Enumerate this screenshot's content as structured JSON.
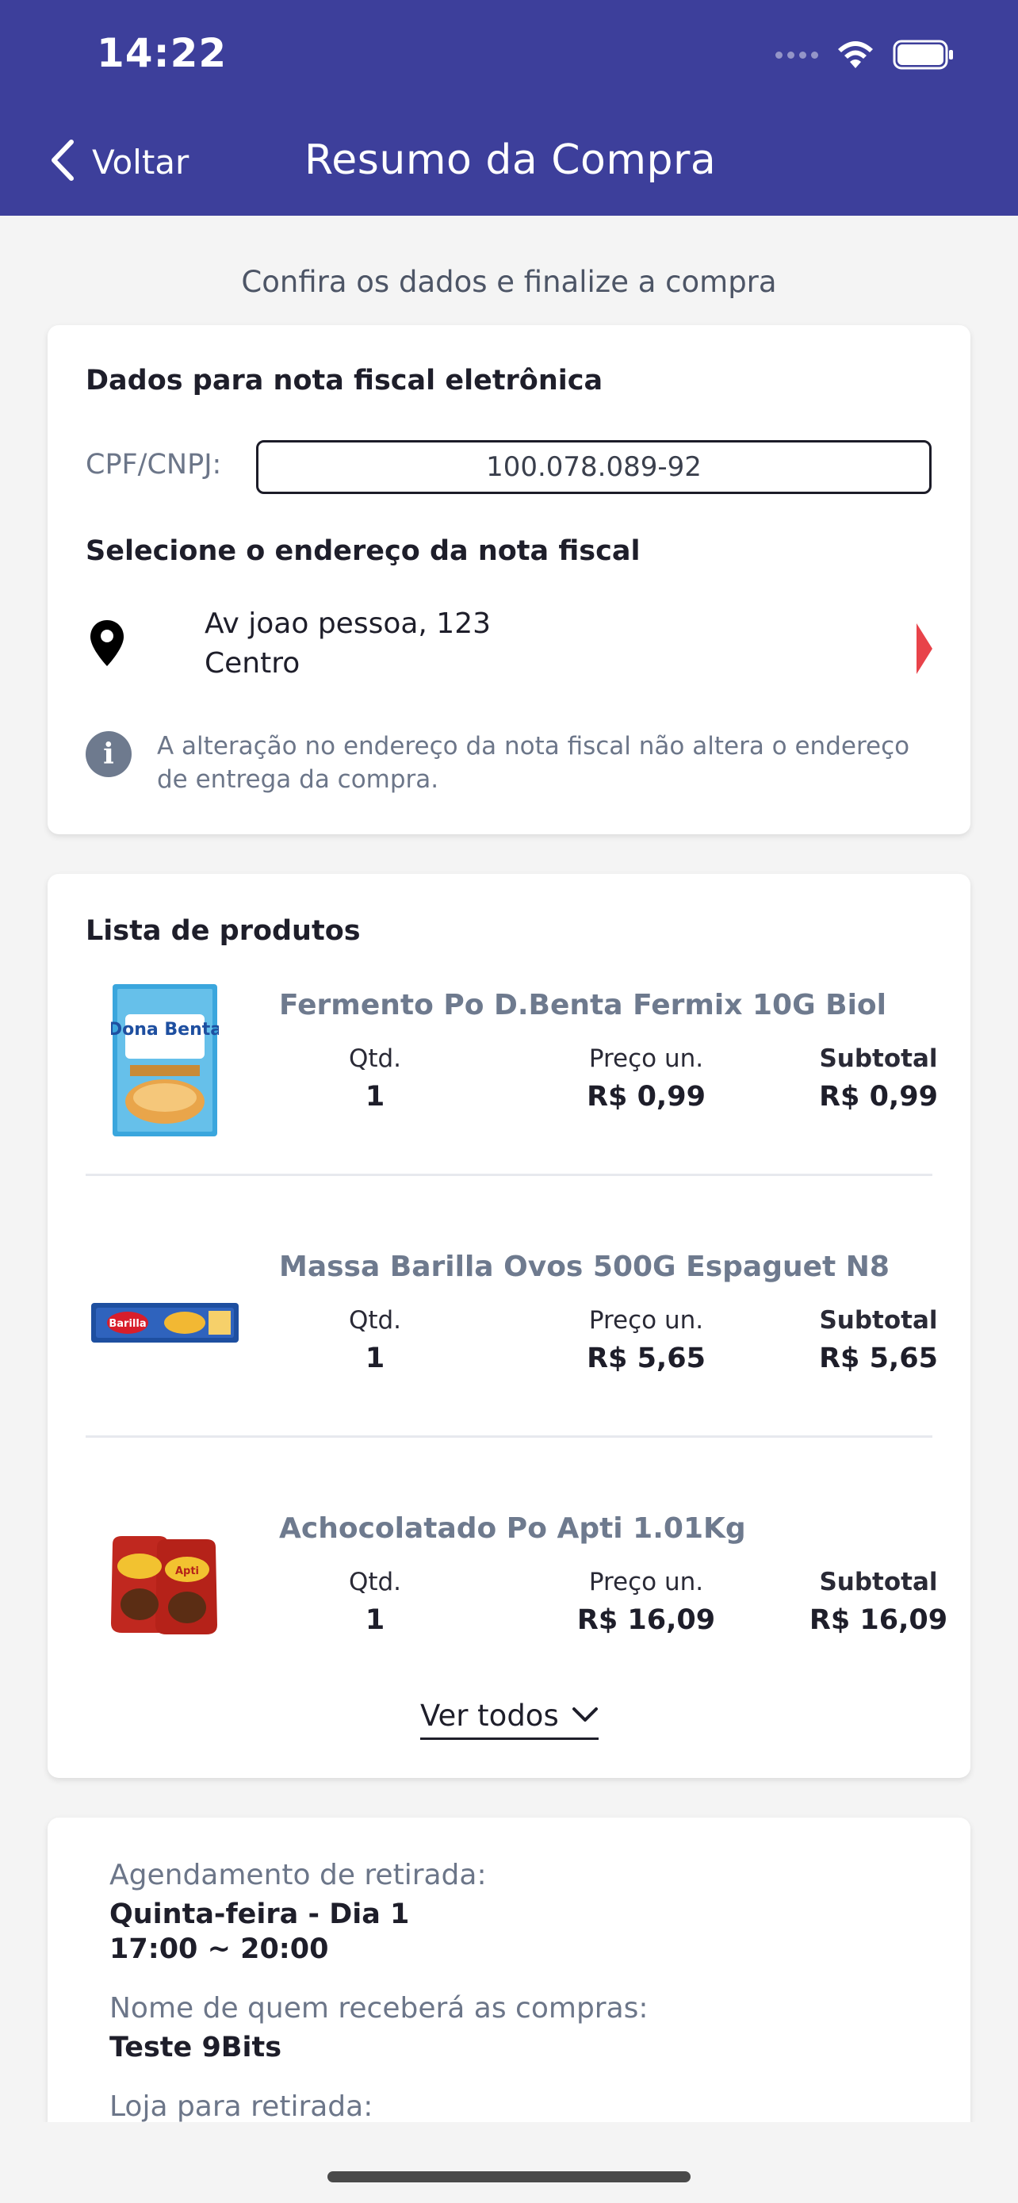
{
  "status_bar": {
    "time": "14:22",
    "signal_icon": "cellular-signal-icon",
    "wifi_icon": "wifi-icon",
    "battery_icon": "battery-icon"
  },
  "header": {
    "back_label": "Voltar",
    "title": "Resumo da Compra",
    "background": "#3d3f9b"
  },
  "subtitle": "Confira os dados e finalize a compra",
  "invoice": {
    "title": "Dados para nota fiscal eletrônica",
    "cpf_label": "CPF/CNPJ:",
    "cpf_value": "100.078.089-92",
    "address_title": "Selecione o endereço da nota fiscal",
    "address_line1": "Av joao pessoa, 123",
    "address_line2": "Centro",
    "info_text": "A alteração no endereço da nota fiscal não altera o endereço de entrega da compra."
  },
  "products": {
    "title": "Lista de produtos",
    "qty_label": "Qtd.",
    "price_label": "Preço un.",
    "subtotal_label": "Subtotal",
    "items": [
      {
        "name": "Fermento Po D.Benta Fermix 10G Biol",
        "qty": "1",
        "price": "R$ 0,99",
        "subtotal": "R$ 0,99",
        "brand_text": "Dona Benta"
      },
      {
        "name": "Massa Barilla Ovos 500G Espaguet N8",
        "qty": "1",
        "price": "R$ 5,65",
        "subtotal": "R$ 5,65",
        "brand_text": "Barilla"
      },
      {
        "name": "Achocolatado Po Apti 1.01Kg",
        "qty": "1",
        "price": "R$ 16,09",
        "subtotal": "R$ 16,09",
        "brand_text": "Apti"
      }
    ],
    "see_all": "Ver todos"
  },
  "pickup": {
    "schedule_label": "Agendamento de retirada:",
    "schedule_day": "Quinta-feira - Dia 1",
    "schedule_time": "17:00 ~ 20:00",
    "receiver_label": "Nome de quem receberá as compras:",
    "receiver_name": "Teste 9Bits",
    "store_label": "Loja para retirada:"
  },
  "colors": {
    "accent": "#3d3f9b",
    "chevron": "#e8434a",
    "muted": "#6c7689"
  }
}
